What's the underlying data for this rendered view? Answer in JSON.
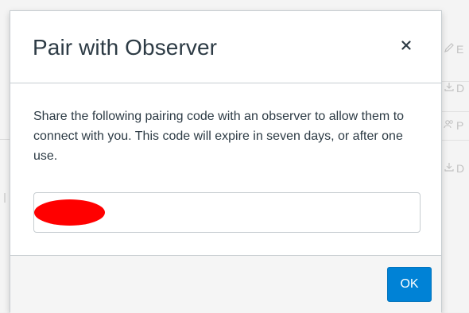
{
  "dialog": {
    "title": "Pair with Observer",
    "close_label": "×",
    "message": "Share the following pairing code with an observer to allow them to connect with you. This code will expire in seven days, or after one use.",
    "pairing_code": "",
    "ok_label": "OK"
  },
  "background": {
    "sidebar_items": [
      {
        "icon": "pencil-icon",
        "letter": "E"
      },
      {
        "icon": "download-icon",
        "letter": "D"
      },
      {
        "icon": "people-icon",
        "letter": "P"
      },
      {
        "icon": "download-icon",
        "letter": "D"
      }
    ]
  },
  "colors": {
    "primary_button": "#0082d6",
    "text": "#2d3b45",
    "border": "#c7cdd1",
    "footer_bg": "#f5f5f5",
    "redaction": "#ff0000"
  }
}
